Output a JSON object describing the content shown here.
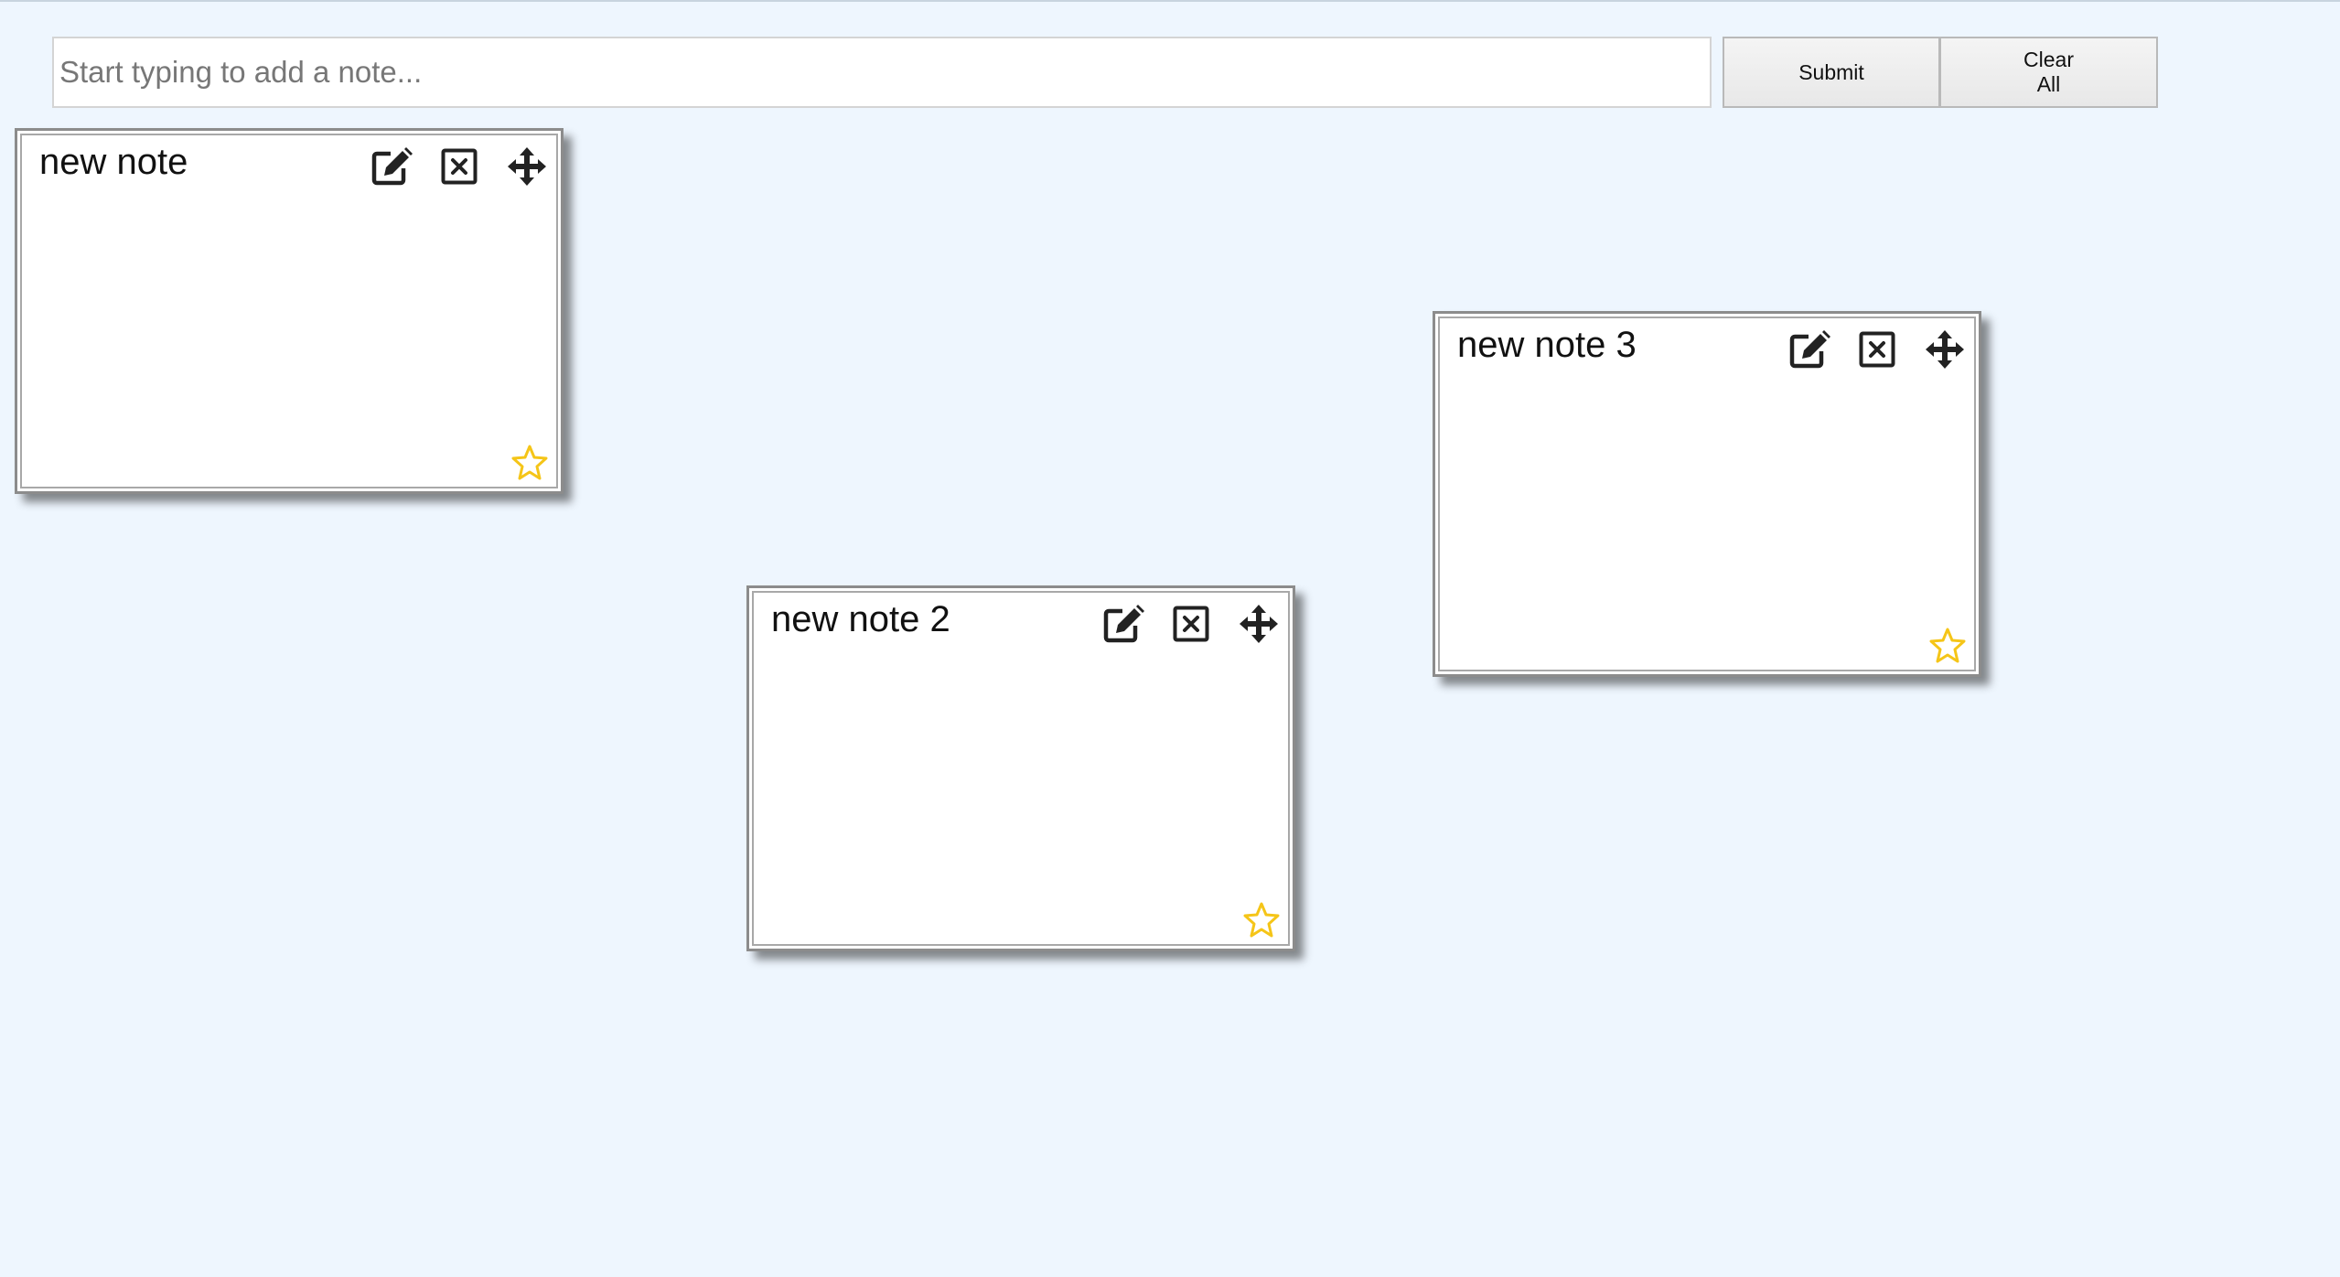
{
  "input": {
    "placeholder": "Start typing to add a note...",
    "value": ""
  },
  "buttons": {
    "submit_label": "Submit",
    "clear_label": "Clear All"
  },
  "notes": [
    {
      "title": "new note",
      "starred": false
    },
    {
      "title": "new note 2",
      "starred": false
    },
    {
      "title": "new note 3",
      "starred": false
    }
  ],
  "icons": {
    "edit": "edit-icon",
    "delete": "close-box-icon",
    "move": "move-icon",
    "favorite": "star-outline-icon"
  },
  "colors": {
    "background": "#eef6fe",
    "star": "#f5c518",
    "icon": "#222222"
  }
}
